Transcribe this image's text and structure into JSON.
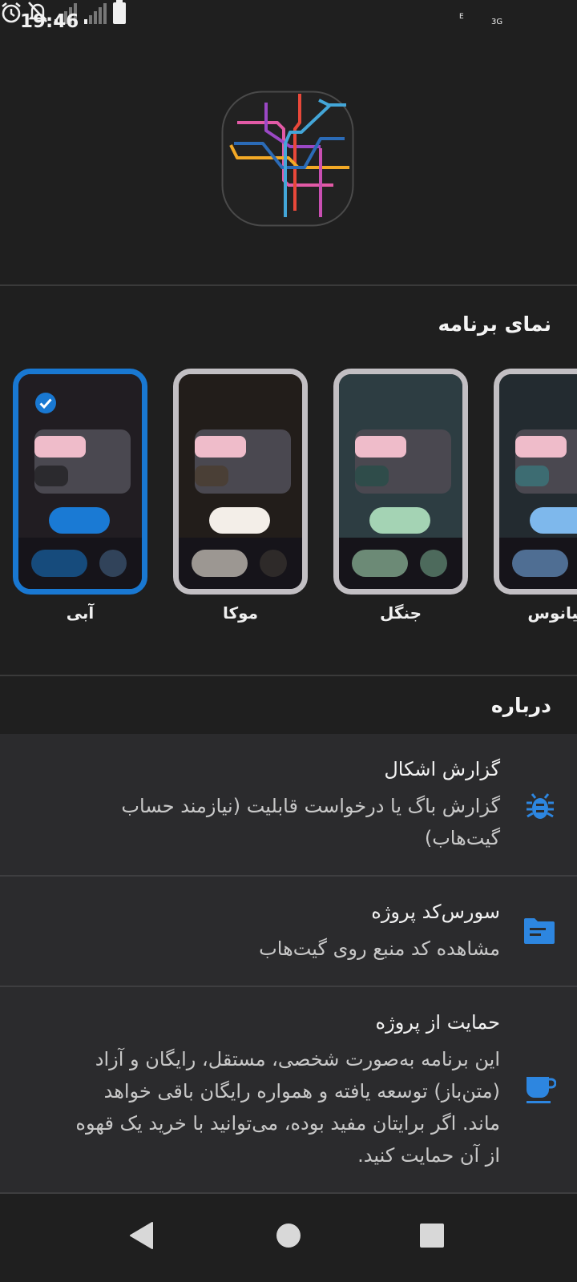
{
  "status_bar": {
    "time": "19:46",
    "network_label": "3G",
    "edge_label": "E",
    "icons": [
      "alarm-icon",
      "notifications-off-icon",
      "signal-icon",
      "signal-icon",
      "battery-icon"
    ]
  },
  "logo": {
    "icon": "metro-map-icon"
  },
  "appearance": {
    "title": "نمای برنامه",
    "themes": [
      {
        "label": "آبی",
        "selected": true,
        "colors": {
          "bg": "#211d22",
          "pill2": "#2b2a2e",
          "button": "#1a7ad4",
          "bottom1": "#164b7c",
          "bottom2": "#31435a"
        }
      },
      {
        "label": "موکا",
        "selected": false,
        "colors": {
          "bg": "#221d1a",
          "pill2": "#4a3f36",
          "button": "#f3eee8",
          "bottom1": "#9c9792",
          "bottom2": "#2e2a29"
        }
      },
      {
        "label": "جنگل",
        "selected": false,
        "colors": {
          "bg": "#2d3d42",
          "pill2": "#2f4c4a",
          "button": "#a4d3b4",
          "bottom1": "#6c8a76",
          "bottom2": "#4d6a5c"
        }
      },
      {
        "label": "اقیانوس",
        "selected": false,
        "colors": {
          "bg": "#232b30",
          "pill2": "#3d6c72",
          "button": "#7eb8ec",
          "bottom1": "#4f6e93",
          "bottom2": "#3a4a5a"
        }
      }
    ]
  },
  "about": {
    "title": "درباره",
    "items": [
      {
        "title": "گزارش اشکال",
        "description": [
          "گزارش باگ یا درخواست قابلیت (نیازمند حساب",
          "گیت‌هاب)"
        ],
        "icon": "bug-icon"
      },
      {
        "title": "سورس‌کد پروژه",
        "description": [
          "مشاهده کد منبع روی گیت‌هاب"
        ],
        "icon": "folder-icon"
      },
      {
        "title": "حمایت از پروژه",
        "description": [
          "این برنامه به‌صورت شخصی، مستقل، رایگان و آزاد",
          "(متن‌باز) توسعه یافته و همواره رایگان باقی خواهد",
          "ماند. اگر برایتان مفید بوده، می‌توانید با خرید یک قهوه",
          "از آن حمایت کنید."
        ],
        "icon": "coffee-icon"
      }
    ]
  },
  "colors": {
    "accent": "#1978d2",
    "background": "#1f1f1f",
    "surface": "#2b2b2d"
  }
}
